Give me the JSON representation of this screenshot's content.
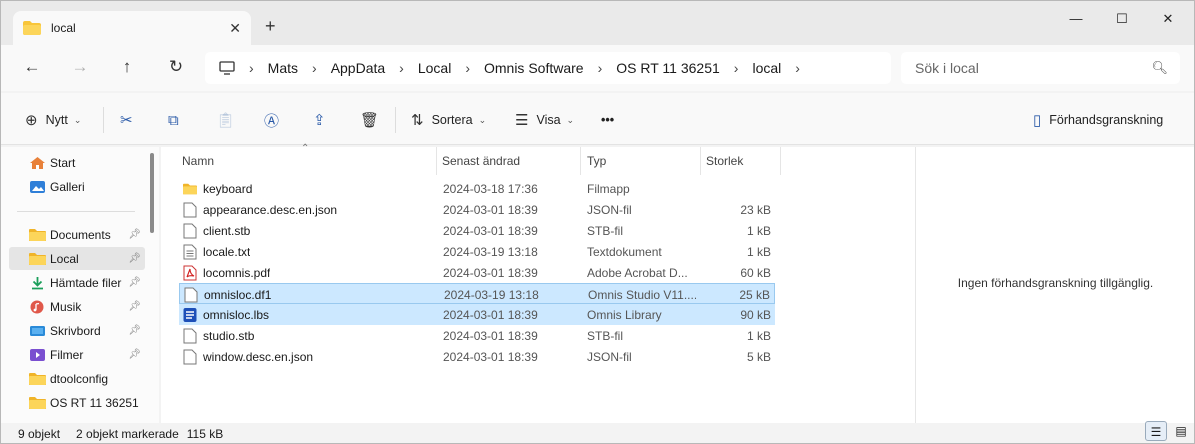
{
  "window": {
    "tab_title": "local",
    "new_tab_label": "+",
    "minimize": "—",
    "maximize": "☐",
    "close": "✕"
  },
  "nav": {
    "breadcrumbs": [
      "Mats",
      "AppData",
      "Local",
      "Omnis Software",
      "OS RT 11 36251",
      "local"
    ],
    "search_placeholder": "Sök i local"
  },
  "toolbar": {
    "new_label": "Nytt",
    "sort_label": "Sortera",
    "view_label": "Visa",
    "more_label": "•••",
    "preview_label": "Förhandsgranskning"
  },
  "sidebar": {
    "items": [
      {
        "label": "Start",
        "icon": "home-icon"
      },
      {
        "label": "Galleri",
        "icon": "gallery-icon"
      },
      {
        "label": "Documents",
        "icon": "folder-icon",
        "pinned": true
      },
      {
        "label": "Local",
        "icon": "folder-icon",
        "pinned": true,
        "selected": true
      },
      {
        "label": "Hämtade filer",
        "icon": "download-icon",
        "pinned": true
      },
      {
        "label": "Musik",
        "icon": "music-icon",
        "pinned": true
      },
      {
        "label": "Skrivbord",
        "icon": "desktop-icon",
        "pinned": true
      },
      {
        "label": "Filmer",
        "icon": "video-icon",
        "pinned": true
      },
      {
        "label": "dtoolconfig",
        "icon": "folder-icon"
      },
      {
        "label": "OS RT 11 36251",
        "icon": "folder-icon"
      }
    ]
  },
  "columns": {
    "name": "Namn",
    "date": "Senast ändrad",
    "type": "Typ",
    "size": "Storlek"
  },
  "files": [
    {
      "name": "keyboard",
      "date": "2024-03-18 17:36",
      "type": "Filmapp",
      "size": "",
      "icon": "folder-icon"
    },
    {
      "name": "appearance.desc.en.json",
      "date": "2024-03-01 18:39",
      "type": "JSON-fil",
      "size": "23 kB",
      "icon": "file-icon"
    },
    {
      "name": "client.stb",
      "date": "2024-03-01 18:39",
      "type": "STB-fil",
      "size": "1 kB",
      "icon": "file-icon"
    },
    {
      "name": "locale.txt",
      "date": "2024-03-19 13:18",
      "type": "Textdokument",
      "size": "1 kB",
      "icon": "text-file-icon"
    },
    {
      "name": "locomnis.pdf",
      "date": "2024-03-01 18:39",
      "type": "Adobe Acrobat D...",
      "size": "60 kB",
      "icon": "pdf-icon"
    },
    {
      "name": "omnisloc.df1",
      "date": "2024-03-19 13:18",
      "type": "Omnis Studio V11....",
      "size": "25 kB",
      "icon": "file-icon",
      "selected": true
    },
    {
      "name": "omnisloc.lbs",
      "date": "2024-03-01 18:39",
      "type": "Omnis Library",
      "size": "90 kB",
      "icon": "omnis-library-icon",
      "selected": true
    },
    {
      "name": "studio.stb",
      "date": "2024-03-01 18:39",
      "type": "STB-fil",
      "size": "1 kB",
      "icon": "file-icon"
    },
    {
      "name": "window.desc.en.json",
      "date": "2024-03-01 18:39",
      "type": "JSON-fil",
      "size": "5 kB",
      "icon": "file-icon"
    }
  ],
  "preview": {
    "empty_text": "Ingen förhandsgranskning tillgänglig."
  },
  "status": {
    "count": "9 objekt",
    "selected": "2 objekt markerade",
    "selected_size": "115 kB"
  },
  "colors": {
    "accent": "#0067c0",
    "selection": "#cce8ff",
    "folder": "#f8c53a"
  }
}
